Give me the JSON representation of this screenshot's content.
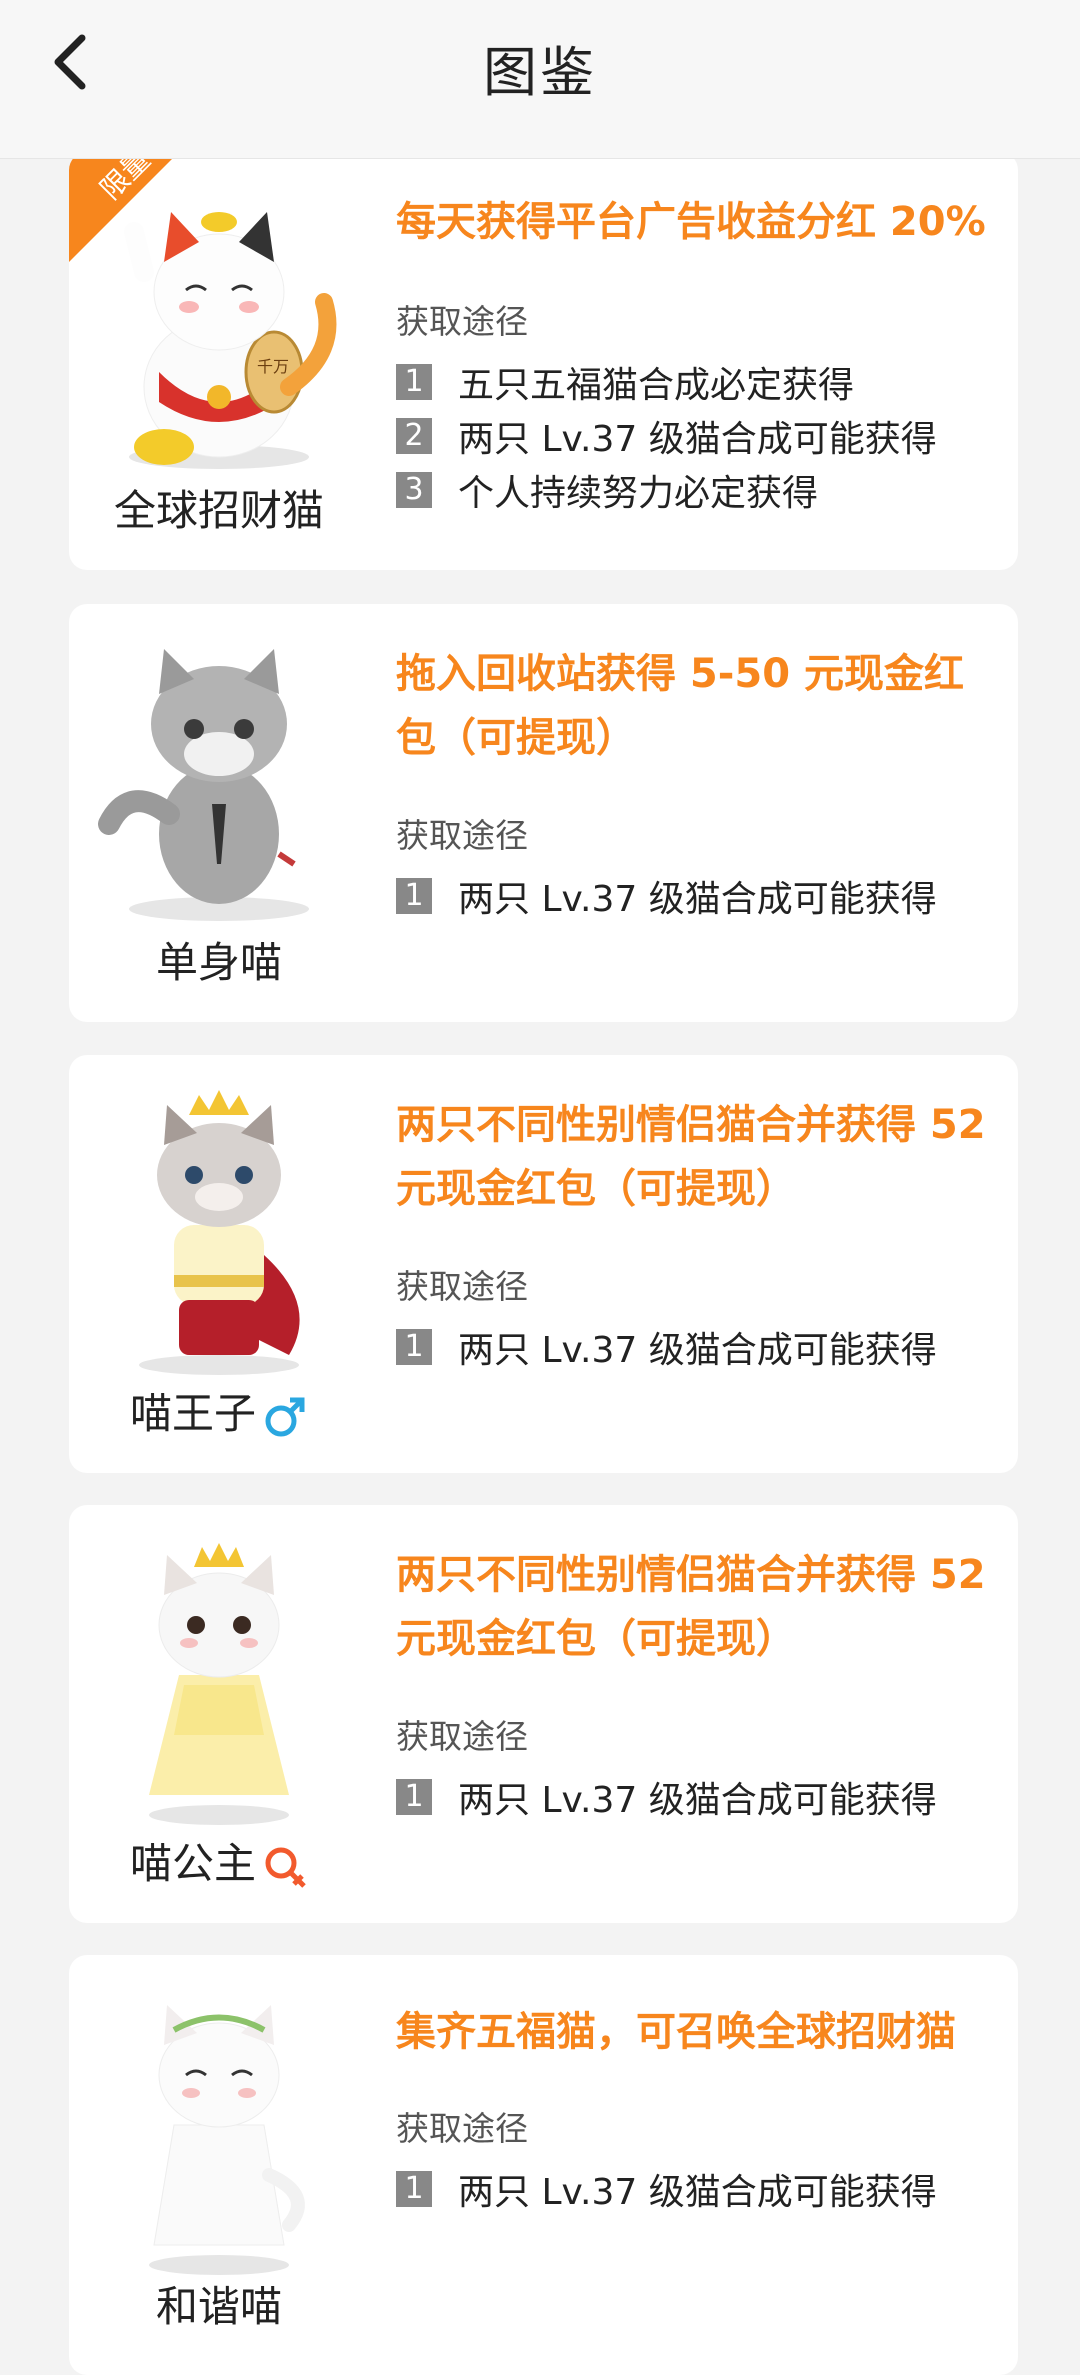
{
  "header": {
    "title": "图鉴",
    "back_icon": "chevron-left-icon"
  },
  "colors": {
    "accent": "#f7861d",
    "badge": "#888888",
    "male": "#2aa7e0",
    "female": "#f25a2d"
  },
  "cards": [
    {
      "name": "全球招财猫",
      "limited_label": "限量",
      "reward": "每天获得平台广告收益分红 20%",
      "source_title": "获取途径",
      "ways": [
        {
          "num": "1",
          "text": "五只五福猫合成必定获得"
        },
        {
          "num": "2",
          "text": "两只 Lv.37 级猫合成可能获得"
        },
        {
          "num": "3",
          "text": "个人持续努力必定获得"
        }
      ]
    },
    {
      "name": "单身喵",
      "reward": "拖入回收站获得 5-50 元现金红包（可提现）",
      "source_title": "获取途径",
      "ways": [
        {
          "num": "1",
          "text": "两只 Lv.37 级猫合成可能获得"
        }
      ]
    },
    {
      "name": "喵王子",
      "gender_icon": "male-icon",
      "reward": "两只不同性别情侣猫合并获得 52 元现金红包（可提现）",
      "source_title": "获取途径",
      "ways": [
        {
          "num": "1",
          "text": "两只 Lv.37 级猫合成可能获得"
        }
      ]
    },
    {
      "name": "喵公主",
      "gender_icon": "female-icon",
      "reward": "两只不同性别情侣猫合并获得 52 元现金红包（可提现）",
      "source_title": "获取途径",
      "ways": [
        {
          "num": "1",
          "text": "两只 Lv.37 级猫合成可能获得"
        }
      ]
    },
    {
      "name": "和谐喵",
      "reward": "集齐五福猫，可召唤全球招财猫",
      "source_title": "获取途径",
      "ways": [
        {
          "num": "1",
          "text": "两只 Lv.37 级猫合成可能获得"
        }
      ]
    }
  ]
}
